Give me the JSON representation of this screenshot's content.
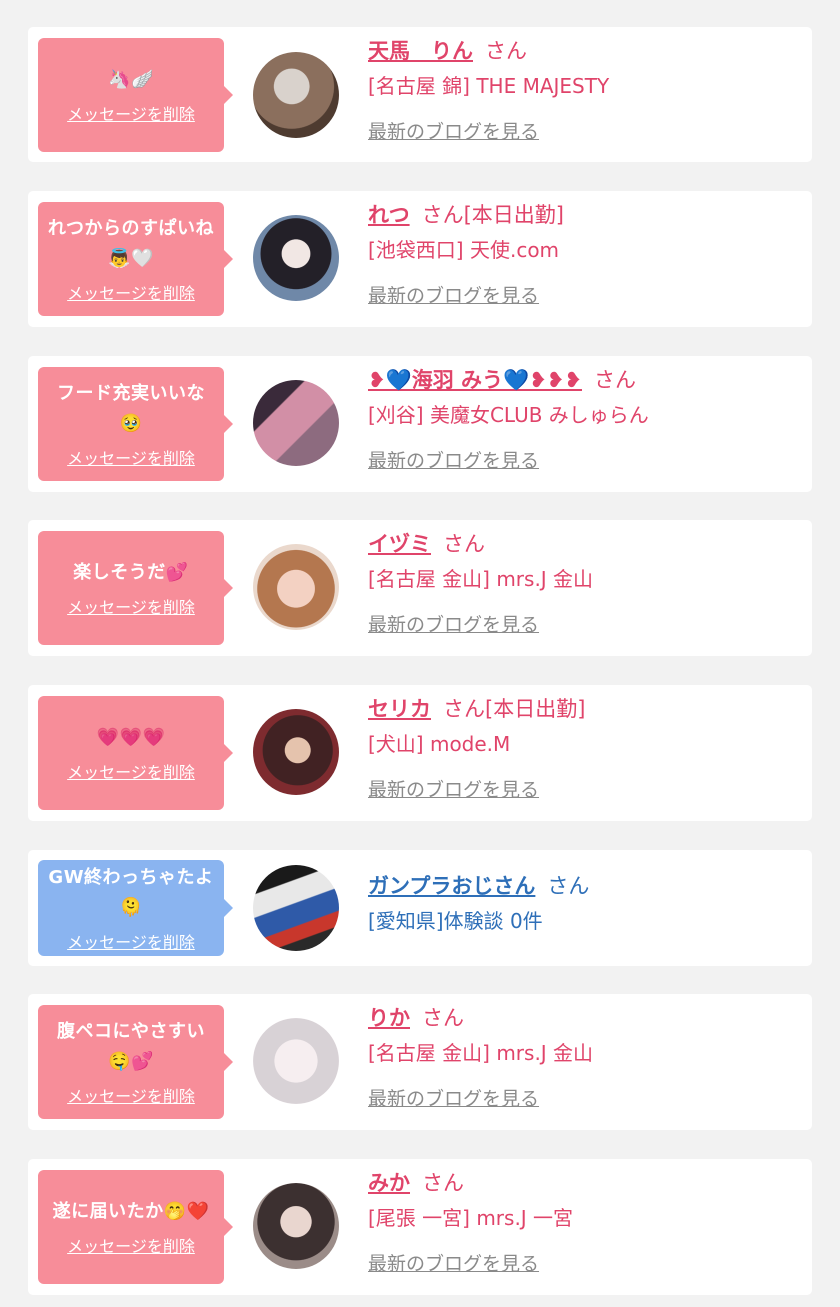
{
  "delete_label": "メッセージを削除",
  "blog_label": "最新のブログを見る",
  "honorific": "さん",
  "items": [
    {
      "message": "🦄🪽",
      "name": "天馬　りん",
      "suffix": "",
      "shop": "[名古屋 錦] THE MAJESTY",
      "theme": "pink",
      "blog": true
    },
    {
      "message": "れつからのすぱいね👼🤍",
      "name": "れつ",
      "suffix": "[本日出勤]",
      "shop": "[池袋西口] 天使.com",
      "theme": "pink",
      "blog": true
    },
    {
      "message": "フード充実いいな🥹",
      "name": "❥💙海羽 みう💙❥❥❥",
      "suffix": "",
      "shop": "[刈谷] 美魔女CLUB みしゅらん",
      "theme": "pink",
      "blog": true
    },
    {
      "message": "楽しそうだ💕",
      "name": "イヅミ",
      "suffix": "",
      "shop": "[名古屋 金山] mrs.J 金山",
      "theme": "pink",
      "blog": true
    },
    {
      "message": "💗💗💗",
      "name": "セリカ",
      "suffix": "[本日出勤]",
      "shop": "[犬山] mode.M",
      "theme": "pink",
      "blog": true
    },
    {
      "message": "GW終わっちゃたよ🫠",
      "name": "ガンプラおじさん",
      "suffix": "",
      "shop": "[愛知県]体験談 0件",
      "theme": "blue",
      "blog": false
    },
    {
      "message": "腹ペコにやさすい🤤💕",
      "name": "りか",
      "suffix": "",
      "shop": "[名古屋 金山] mrs.J 金山",
      "theme": "pink",
      "blog": true
    },
    {
      "message": "遂に届いたか🤭❤️",
      "name": "みか",
      "suffix": "",
      "shop": "[尾張 一宮] mrs.J 一宮",
      "theme": "pink",
      "blog": true
    }
  ],
  "colors": {
    "pink_bubble": "#f78d99",
    "blue_bubble": "#8ab4f0",
    "pink_text": "#e0446a",
    "blue_text": "#2e6fb8"
  }
}
